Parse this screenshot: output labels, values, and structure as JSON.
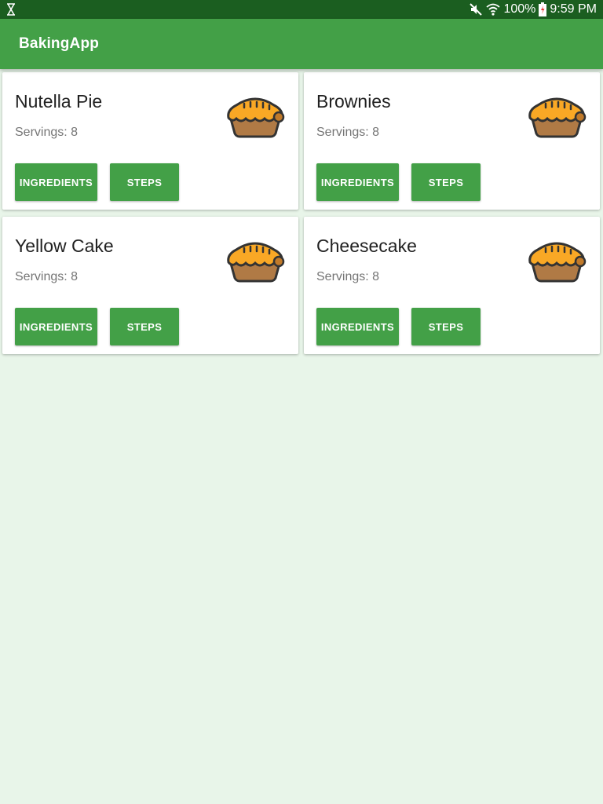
{
  "status_bar": {
    "battery": "100%",
    "time": "9:59 PM",
    "icons": [
      "hourglass-icon",
      "mute-icon",
      "wifi-icon",
      "battery-icon"
    ]
  },
  "app_bar": {
    "title": "BakingApp"
  },
  "colors": {
    "status_bar": "#1b5e20",
    "primary": "#43a047",
    "background": "#e8f5e9",
    "pie_crust": "#f9a825",
    "pie_base": "#b07a45"
  },
  "recipes": [
    {
      "name": "Nutella Pie",
      "servings": "Servings: 8",
      "icon": "pie-icon",
      "ingredients_label": "INGREDIENTS",
      "steps_label": "STEPS"
    },
    {
      "name": "Brownies",
      "servings": "Servings: 8",
      "icon": "pie-icon",
      "ingredients_label": "INGREDIENTS",
      "steps_label": "STEPS"
    },
    {
      "name": "Yellow Cake",
      "servings": "Servings: 8",
      "icon": "pie-icon",
      "ingredients_label": "INGREDIENTS",
      "steps_label": "STEPS"
    },
    {
      "name": "Cheesecake",
      "servings": "Servings: 8",
      "icon": "pie-icon",
      "ingredients_label": "INGREDIENTS",
      "steps_label": "STEPS"
    }
  ]
}
